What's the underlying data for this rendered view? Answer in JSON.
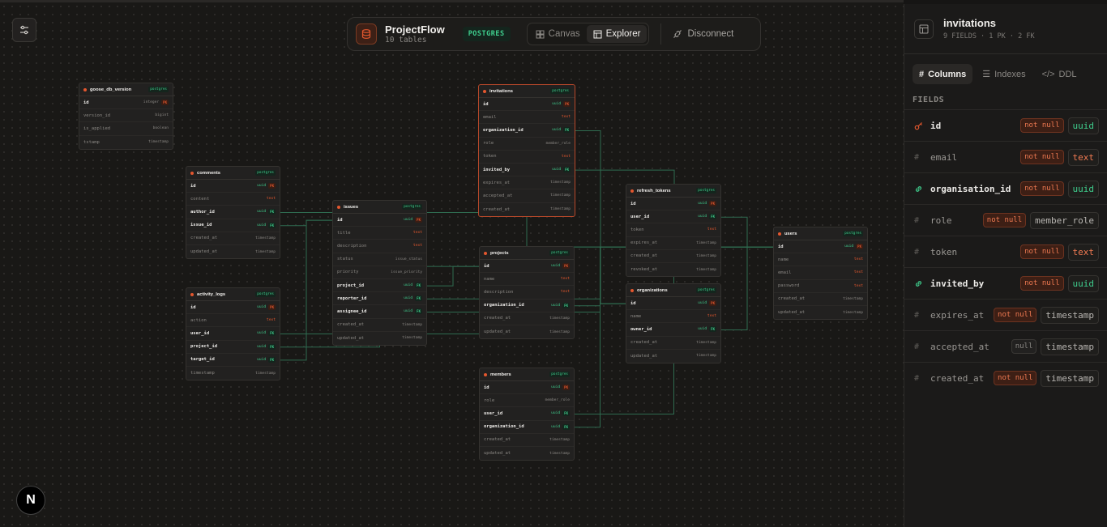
{
  "topbar": {
    "project_name": "ProjectFlow",
    "table_count": "10 tables",
    "db_badge": "POSTGRES",
    "canvas_label": "Canvas",
    "explorer_label": "Explorer",
    "disconnect_label": "Disconnect"
  },
  "next_logo": "N",
  "tables": [
    {
      "id": "goose_db_version",
      "name": "goose_db_version",
      "badge": "postgres",
      "cols": [
        [
          "id",
          "integer",
          "pk"
        ],
        [
          "version_id",
          "bigint",
          ""
        ],
        [
          "is_applied",
          "boolean",
          ""
        ],
        [
          "tstamp",
          "timestamp",
          ""
        ]
      ]
    },
    {
      "id": "comments",
      "name": "comments",
      "badge": "postgres",
      "cols": [
        [
          "id",
          "uuid",
          "pk"
        ],
        [
          "content",
          "text",
          ""
        ],
        [
          "author_id",
          "uuid",
          "fk"
        ],
        [
          "issue_id",
          "uuid",
          "fk"
        ],
        [
          "created_at",
          "timestamp",
          ""
        ],
        [
          "updated_at",
          "timestamp",
          ""
        ]
      ]
    },
    {
      "id": "activity_logs",
      "name": "activity_logs",
      "badge": "postgres",
      "cols": [
        [
          "id",
          "uuid",
          "pk"
        ],
        [
          "action",
          "text",
          ""
        ],
        [
          "user_id",
          "uuid",
          "fk"
        ],
        [
          "project_id",
          "uuid",
          "fk"
        ],
        [
          "target_id",
          "uuid",
          "fk"
        ],
        [
          "timestamp",
          "timestamp",
          ""
        ]
      ]
    },
    {
      "id": "issues",
      "name": "issues",
      "badge": "postgres",
      "cols": [
        [
          "id",
          "uuid",
          "pk"
        ],
        [
          "title",
          "text",
          ""
        ],
        [
          "description",
          "text",
          ""
        ],
        [
          "status",
          "issue_status",
          ""
        ],
        [
          "priority",
          "issue_priority",
          ""
        ],
        [
          "project_id",
          "uuid",
          "fk"
        ],
        [
          "reporter_id",
          "uuid",
          "fk"
        ],
        [
          "assignee_id",
          "uuid",
          "fk"
        ],
        [
          "created_at",
          "timestamp",
          ""
        ],
        [
          "updated_at",
          "timestamp",
          ""
        ]
      ]
    },
    {
      "id": "invitations",
      "name": "invitations",
      "badge": "postgres",
      "cols": [
        [
          "id",
          "uuid",
          "pk"
        ],
        [
          "email",
          "text",
          ""
        ],
        [
          "organization_id",
          "uuid",
          "fk"
        ],
        [
          "role",
          "member_role",
          ""
        ],
        [
          "token",
          "text",
          ""
        ],
        [
          "invited_by",
          "uuid",
          "fk"
        ],
        [
          "expires_at",
          "timestamp",
          ""
        ],
        [
          "accepted_at",
          "timestamp",
          ""
        ],
        [
          "created_at",
          "timestamp",
          ""
        ]
      ]
    },
    {
      "id": "projects",
      "name": "projects",
      "badge": "postgres",
      "cols": [
        [
          "id",
          "uuid",
          "pk"
        ],
        [
          "name",
          "text",
          ""
        ],
        [
          "description",
          "text",
          ""
        ],
        [
          "organization_id",
          "uuid",
          "fk"
        ],
        [
          "created_at",
          "timestamp",
          ""
        ],
        [
          "updated_at",
          "timestamp",
          ""
        ]
      ]
    },
    {
      "id": "members",
      "name": "members",
      "badge": "postgres",
      "cols": [
        [
          "id",
          "uuid",
          "pk"
        ],
        [
          "role",
          "member_role",
          ""
        ],
        [
          "user_id",
          "uuid",
          "fk"
        ],
        [
          "organization_id",
          "uuid",
          "fk"
        ],
        [
          "created_at",
          "timestamp",
          ""
        ],
        [
          "updated_at",
          "timestamp",
          ""
        ]
      ]
    },
    {
      "id": "refresh_tokens",
      "name": "refresh_tokens",
      "badge": "postgres",
      "cols": [
        [
          "id",
          "uuid",
          "pk"
        ],
        [
          "user_id",
          "uuid",
          "fk"
        ],
        [
          "token",
          "text",
          ""
        ],
        [
          "expires_at",
          "timestamp",
          ""
        ],
        [
          "created_at",
          "timestamp",
          ""
        ],
        [
          "revoked_at",
          "timestamp",
          ""
        ]
      ]
    },
    {
      "id": "organizations",
      "name": "organizations",
      "badge": "postgres",
      "cols": [
        [
          "id",
          "uuid",
          "pk"
        ],
        [
          "name",
          "text",
          ""
        ],
        [
          "owner_id",
          "uuid",
          "fk"
        ],
        [
          "created_at",
          "timestamp",
          ""
        ],
        [
          "updated_at",
          "timestamp",
          ""
        ]
      ]
    },
    {
      "id": "users",
      "name": "users",
      "badge": "postgres",
      "cols": [
        [
          "id",
          "uuid",
          "pk"
        ],
        [
          "name",
          "text",
          ""
        ],
        [
          "email",
          "text",
          ""
        ],
        [
          "password",
          "text",
          ""
        ],
        [
          "created_at",
          "timestamp",
          ""
        ],
        [
          "updated_at",
          "timestamp",
          ""
        ]
      ]
    }
  ],
  "key_labels": {
    "pk": "PK",
    "fk": "FK"
  },
  "panel": {
    "title": "invitations",
    "meta": "9 FIELDS · 1 PK · 2 FK",
    "tabs": [
      "Columns",
      "Indexes",
      "DDL"
    ],
    "fields_label": "FIELDS",
    "fields": [
      {
        "name": "id",
        "nullability": "not null",
        "type": "uuid",
        "kind": "pk"
      },
      {
        "name": "email",
        "nullability": "not null",
        "type": "text",
        "kind": ""
      },
      {
        "name": "organisation_id",
        "nullability": "not null",
        "type": "uuid",
        "kind": "fk"
      },
      {
        "name": "role",
        "nullability": "not null",
        "type": "member_role",
        "kind": ""
      },
      {
        "name": "token",
        "nullability": "not null",
        "type": "text",
        "kind": ""
      },
      {
        "name": "invited_by",
        "nullability": "not null",
        "type": "uuid",
        "kind": "fk"
      },
      {
        "name": "expires_at",
        "nullability": "not null",
        "type": "timestamp",
        "kind": ""
      },
      {
        "name": "accepted_at",
        "nullability": "null",
        "type": "timestamp",
        "kind": ""
      },
      {
        "name": "created_at",
        "nullability": "not null",
        "type": "timestamp",
        "kind": ""
      }
    ]
  },
  "colors": {
    "accent": "#e4572e",
    "fk_green": "#3fcf8e",
    "edge": "#2f6b50"
  }
}
